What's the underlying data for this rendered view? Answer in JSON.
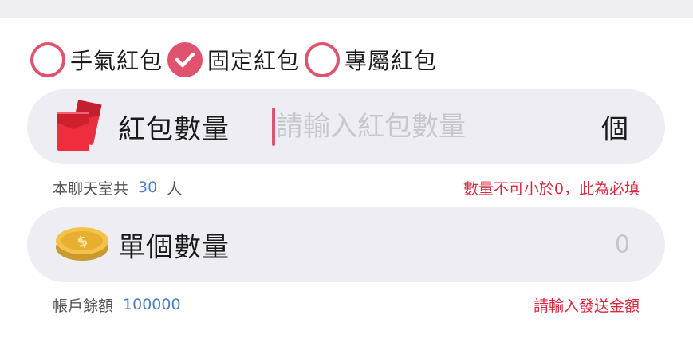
{
  "packet_types": {
    "options": [
      {
        "label": "手氣紅包",
        "checked": false
      },
      {
        "label": "固定紅包",
        "checked": true
      },
      {
        "label": "專屬紅包",
        "checked": false
      }
    ]
  },
  "quantity_field": {
    "title": "紅包數量",
    "placeholder": "請輸入紅包數量",
    "unit": "個",
    "icon": "red-envelope-icon"
  },
  "room_info": {
    "prefix": "本聊天室共",
    "count": "30",
    "suffix": "人",
    "error": "數量不可小於0，此為必填"
  },
  "amount_field": {
    "title": "單個數量",
    "value": "0",
    "icon": "gold-coin-icon"
  },
  "balance_info": {
    "label": "帳戶餘額",
    "value": "100000",
    "hint": "請輸入發送金額"
  },
  "colors": {
    "accent": "#e0536f",
    "error": "#d7283f",
    "link": "#4a7fc1",
    "field_bg": "#eeedf4"
  }
}
